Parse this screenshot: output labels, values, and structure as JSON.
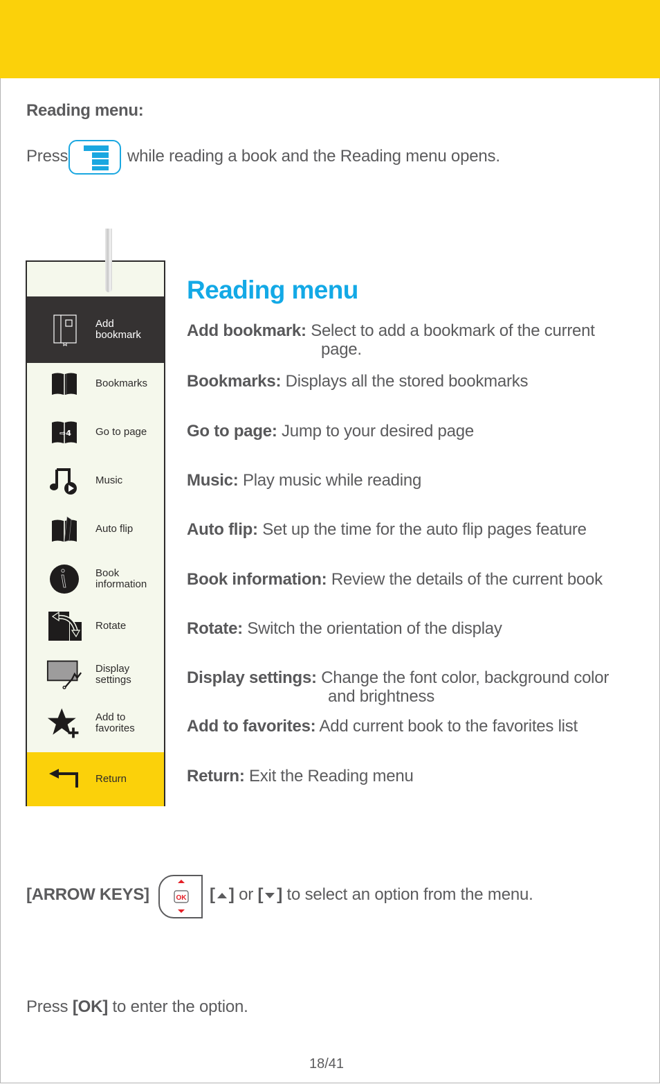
{
  "colors": {
    "header_bar": "#fbd10a",
    "accent_blue": "#13a9e6",
    "text_gray": "#5b5b5d",
    "menu_selected_bg": "#353232",
    "menu_bg": "#f5f8ec",
    "menu_return_bg": "#fbd10a",
    "ok_red": "#e41e26"
  },
  "intro": {
    "title": "Reading menu:",
    "press_before": "Press",
    "press_icon": "menu-key-icon",
    "press_after": "while reading a book and the Reading menu opens."
  },
  "device_menu": {
    "items": [
      {
        "label": "Add\nbookmark",
        "icon": "add-bookmark-icon",
        "selected": true
      },
      {
        "label": "Bookmarks",
        "icon": "bookmarks-icon"
      },
      {
        "label": "Go to page",
        "icon": "go-to-page-icon",
        "icon_text": "⇨4"
      },
      {
        "label": "Music",
        "icon": "music-icon"
      },
      {
        "label": "Auto flip",
        "icon": "auto-flip-icon"
      },
      {
        "label": "Book\ninformation",
        "icon": "book-information-icon"
      },
      {
        "label": "Rotate",
        "icon": "rotate-icon"
      },
      {
        "label": "Display\nsettings",
        "icon": "display-settings-icon"
      },
      {
        "label": "Add to\nfavorites",
        "icon": "add-to-favorites-icon"
      },
      {
        "label": "Return",
        "icon": "return-icon"
      }
    ]
  },
  "descriptions": {
    "heading": "Reading menu",
    "items": [
      {
        "term": "Add bookmark:",
        "text": "Select to add a bookmark of the current",
        "cont": "page."
      },
      {
        "term": "Bookmarks:",
        "text": "Displays all the stored bookmarks"
      },
      {
        "term": "Go to page:",
        "text": "Jump to your desired page"
      },
      {
        "term": "Music:",
        "text": "Play music while reading"
      },
      {
        "term": "Auto flip:",
        "text": "Set up the time for the auto flip pages feature"
      },
      {
        "term": "Book information:",
        "text": "Review the details of the current book"
      },
      {
        "term": "Rotate:",
        "text": "Switch the orientation of the display"
      },
      {
        "term": "Display settings:",
        "text": "Change the font color, background color",
        "cont": "and brightness"
      },
      {
        "term": "Add to favorites:",
        "text": "Add current book to the favorites list"
      },
      {
        "term": "Return:",
        "text": "Exit the Reading menu"
      }
    ]
  },
  "arrow_keys": {
    "label": "[ARROW KEYS]",
    "key_icon_text": "OK",
    "open_bracket": "[",
    "close_bracket": "]",
    "or": "or",
    "text_after": "to select an option from the menu."
  },
  "ok_instruction": {
    "before": "Press",
    "key": "[OK]",
    "after": "to enter the option."
  },
  "page_number": "18/41"
}
